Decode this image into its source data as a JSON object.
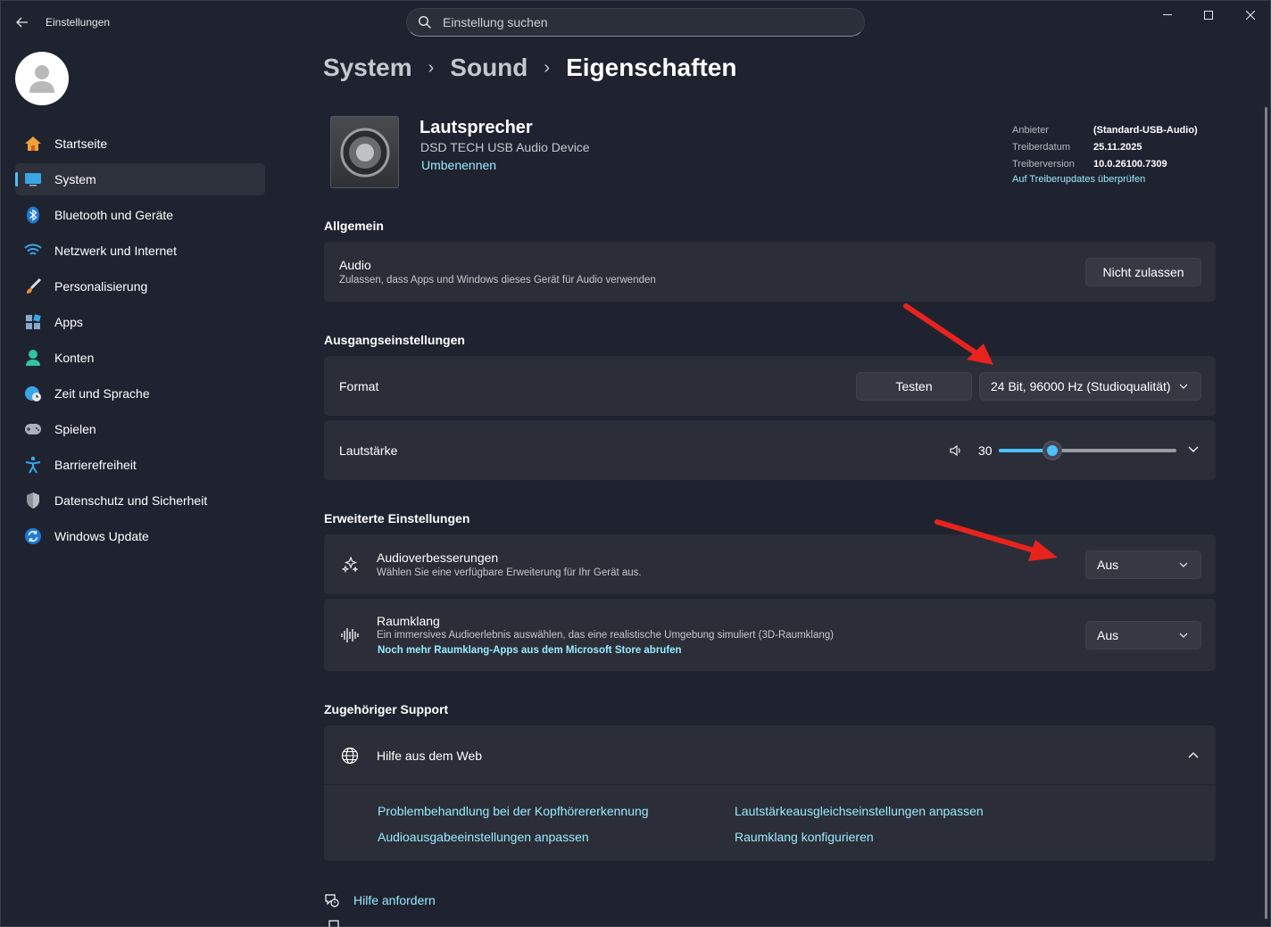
{
  "titlebar": {
    "app_title": "Einstellungen",
    "search_placeholder": "Einstellung suchen"
  },
  "sidebar": {
    "items": [
      {
        "label": "Startseite",
        "icon": "home-icon"
      },
      {
        "label": "System",
        "icon": "system-icon",
        "active": true
      },
      {
        "label": "Bluetooth und Geräte",
        "icon": "bluetooth-icon"
      },
      {
        "label": "Netzwerk und Internet",
        "icon": "wifi-icon"
      },
      {
        "label": "Personalisierung",
        "icon": "brush-icon"
      },
      {
        "label": "Apps",
        "icon": "apps-icon"
      },
      {
        "label": "Konten",
        "icon": "account-icon"
      },
      {
        "label": "Zeit und Sprache",
        "icon": "globe-clock-icon"
      },
      {
        "label": "Spielen",
        "icon": "gamepad-icon"
      },
      {
        "label": "Barrierefreiheit",
        "icon": "accessibility-icon"
      },
      {
        "label": "Datenschutz und Sicherheit",
        "icon": "shield-icon"
      },
      {
        "label": "Windows Update",
        "icon": "update-icon"
      }
    ]
  },
  "breadcrumb": {
    "items": [
      "System",
      "Sound"
    ],
    "current": "Eigenschaften"
  },
  "device": {
    "name": "Lautsprecher",
    "subtitle": "DSD TECH USB Audio Device",
    "rename_link": "Umbenennen",
    "properties": [
      {
        "key": "Anbieter",
        "value": "(Standard-USB-Audio)"
      },
      {
        "key": "Treiberdatum",
        "value": "25.11.2025"
      },
      {
        "key": "Treiberversion",
        "value": "10.0.26100.7309"
      }
    ],
    "driver_update_link": "Auf Treiberupdates überprüfen"
  },
  "general": {
    "title": "Allgemein",
    "audio_title": "Audio",
    "audio_desc": "Zulassen, dass Apps und Windows dieses Gerät für Audio verwenden",
    "audio_button": "Nicht zulassen"
  },
  "output": {
    "title": "Ausgangseinstellungen",
    "format_label": "Format",
    "test_button": "Testen",
    "format_value": "24 Bit, 96000 Hz (Studioqualität)",
    "volume_label": "Lautstärke",
    "volume_value": "30",
    "volume_fraction": 0.3
  },
  "advanced": {
    "title": "Erweiterte Einstellungen",
    "enhance_title": "Audioverbesserungen",
    "enhance_desc": "Wählen Sie eine verfügbare Erweiterung für Ihr Gerät aus.",
    "enhance_value": "Aus",
    "spatial_title": "Raumklang",
    "spatial_desc": "Ein immersives Audioerlebnis auswählen, das eine realistische Umgebung simuliert (3D-Raumklang)",
    "spatial_link": "Noch mehr Raumklang-Apps aus dem Microsoft Store abrufen",
    "spatial_value": "Aus"
  },
  "support": {
    "title": "Zugehöriger Support",
    "web_help": "Hilfe aus dem Web",
    "links": [
      "Problembehandlung bei der Kopfhörererkennung",
      "Lautstärkeausgleichseinstellungen anpassen",
      "Audioausgabeeinstellungen anpassen",
      "Raumklang konfigurieren"
    ],
    "get_help": "Hilfe anfordern"
  },
  "colors": {
    "accent": "#4cc2ff",
    "link": "#99ebff",
    "annotation_arrow": "#e8231d"
  }
}
